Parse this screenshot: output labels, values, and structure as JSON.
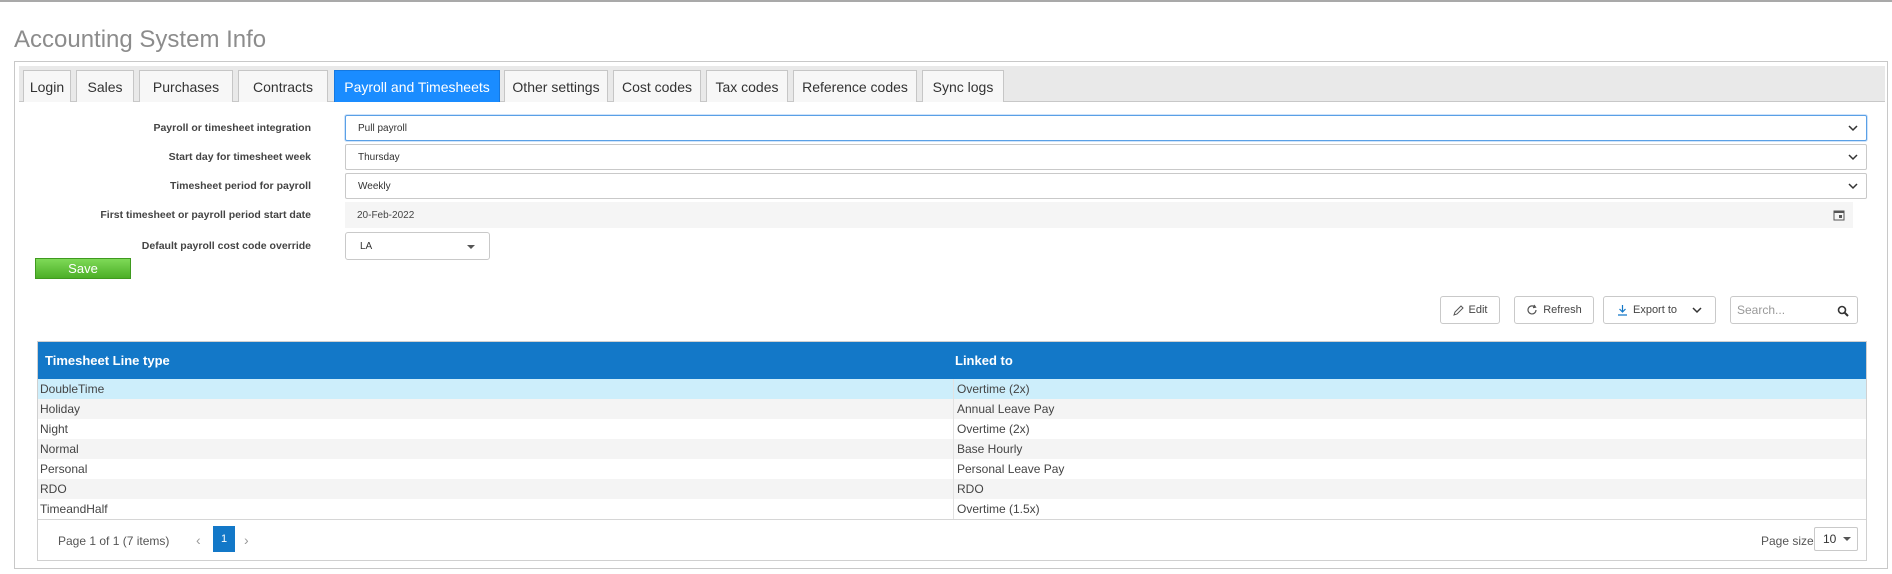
{
  "page": {
    "title": "Accounting System Info"
  },
  "tabs": [
    {
      "label": "Login"
    },
    {
      "label": "Sales"
    },
    {
      "label": "Purchases"
    },
    {
      "label": "Contracts"
    },
    {
      "label": "Payroll and Timesheets"
    },
    {
      "label": "Other settings"
    },
    {
      "label": "Cost codes"
    },
    {
      "label": "Tax codes"
    },
    {
      "label": "Reference codes"
    },
    {
      "label": "Sync logs"
    }
  ],
  "active_tab": "Payroll and Timesheets",
  "form": {
    "integration": {
      "label": "Payroll or timesheet integration",
      "value": "Pull payroll"
    },
    "start_day": {
      "label": "Start day for timesheet week",
      "value": "Thursday"
    },
    "period": {
      "label": "Timesheet period for payroll",
      "value": "Weekly"
    },
    "first_period": {
      "label": "First timesheet or payroll period start date",
      "value": "20-Feb-2022"
    },
    "cost_code": {
      "label": "Default payroll cost code override",
      "value": "LA"
    },
    "save_label": "Save"
  },
  "toolbar": {
    "edit_label": "Edit",
    "refresh_label": "Refresh",
    "export_label": "Export to",
    "search_placeholder": "Search..."
  },
  "grid": {
    "columns": [
      "Timesheet Line type",
      "Linked to"
    ],
    "rows": [
      {
        "type": "DoubleTime",
        "linked": "Overtime (2x)"
      },
      {
        "type": "Holiday",
        "linked": "Annual Leave Pay"
      },
      {
        "type": "Night",
        "linked": "Overtime (2x)"
      },
      {
        "type": "Normal",
        "linked": "Base Hourly"
      },
      {
        "type": "Personal",
        "linked": "Personal Leave Pay"
      },
      {
        "type": "RDO",
        "linked": "RDO"
      },
      {
        "type": "TimeandHalf",
        "linked": "Overtime (1.5x)"
      }
    ],
    "pager": {
      "info": "Page 1 of 1 (7 items)",
      "current_page": "1",
      "page_size_label": "Page size:",
      "page_size": "10"
    }
  },
  "colors": {
    "accent": "#1a8cff",
    "grid_header": "#1378c8",
    "selected_row": "#cdeefb",
    "save_green": "#4caf27"
  }
}
